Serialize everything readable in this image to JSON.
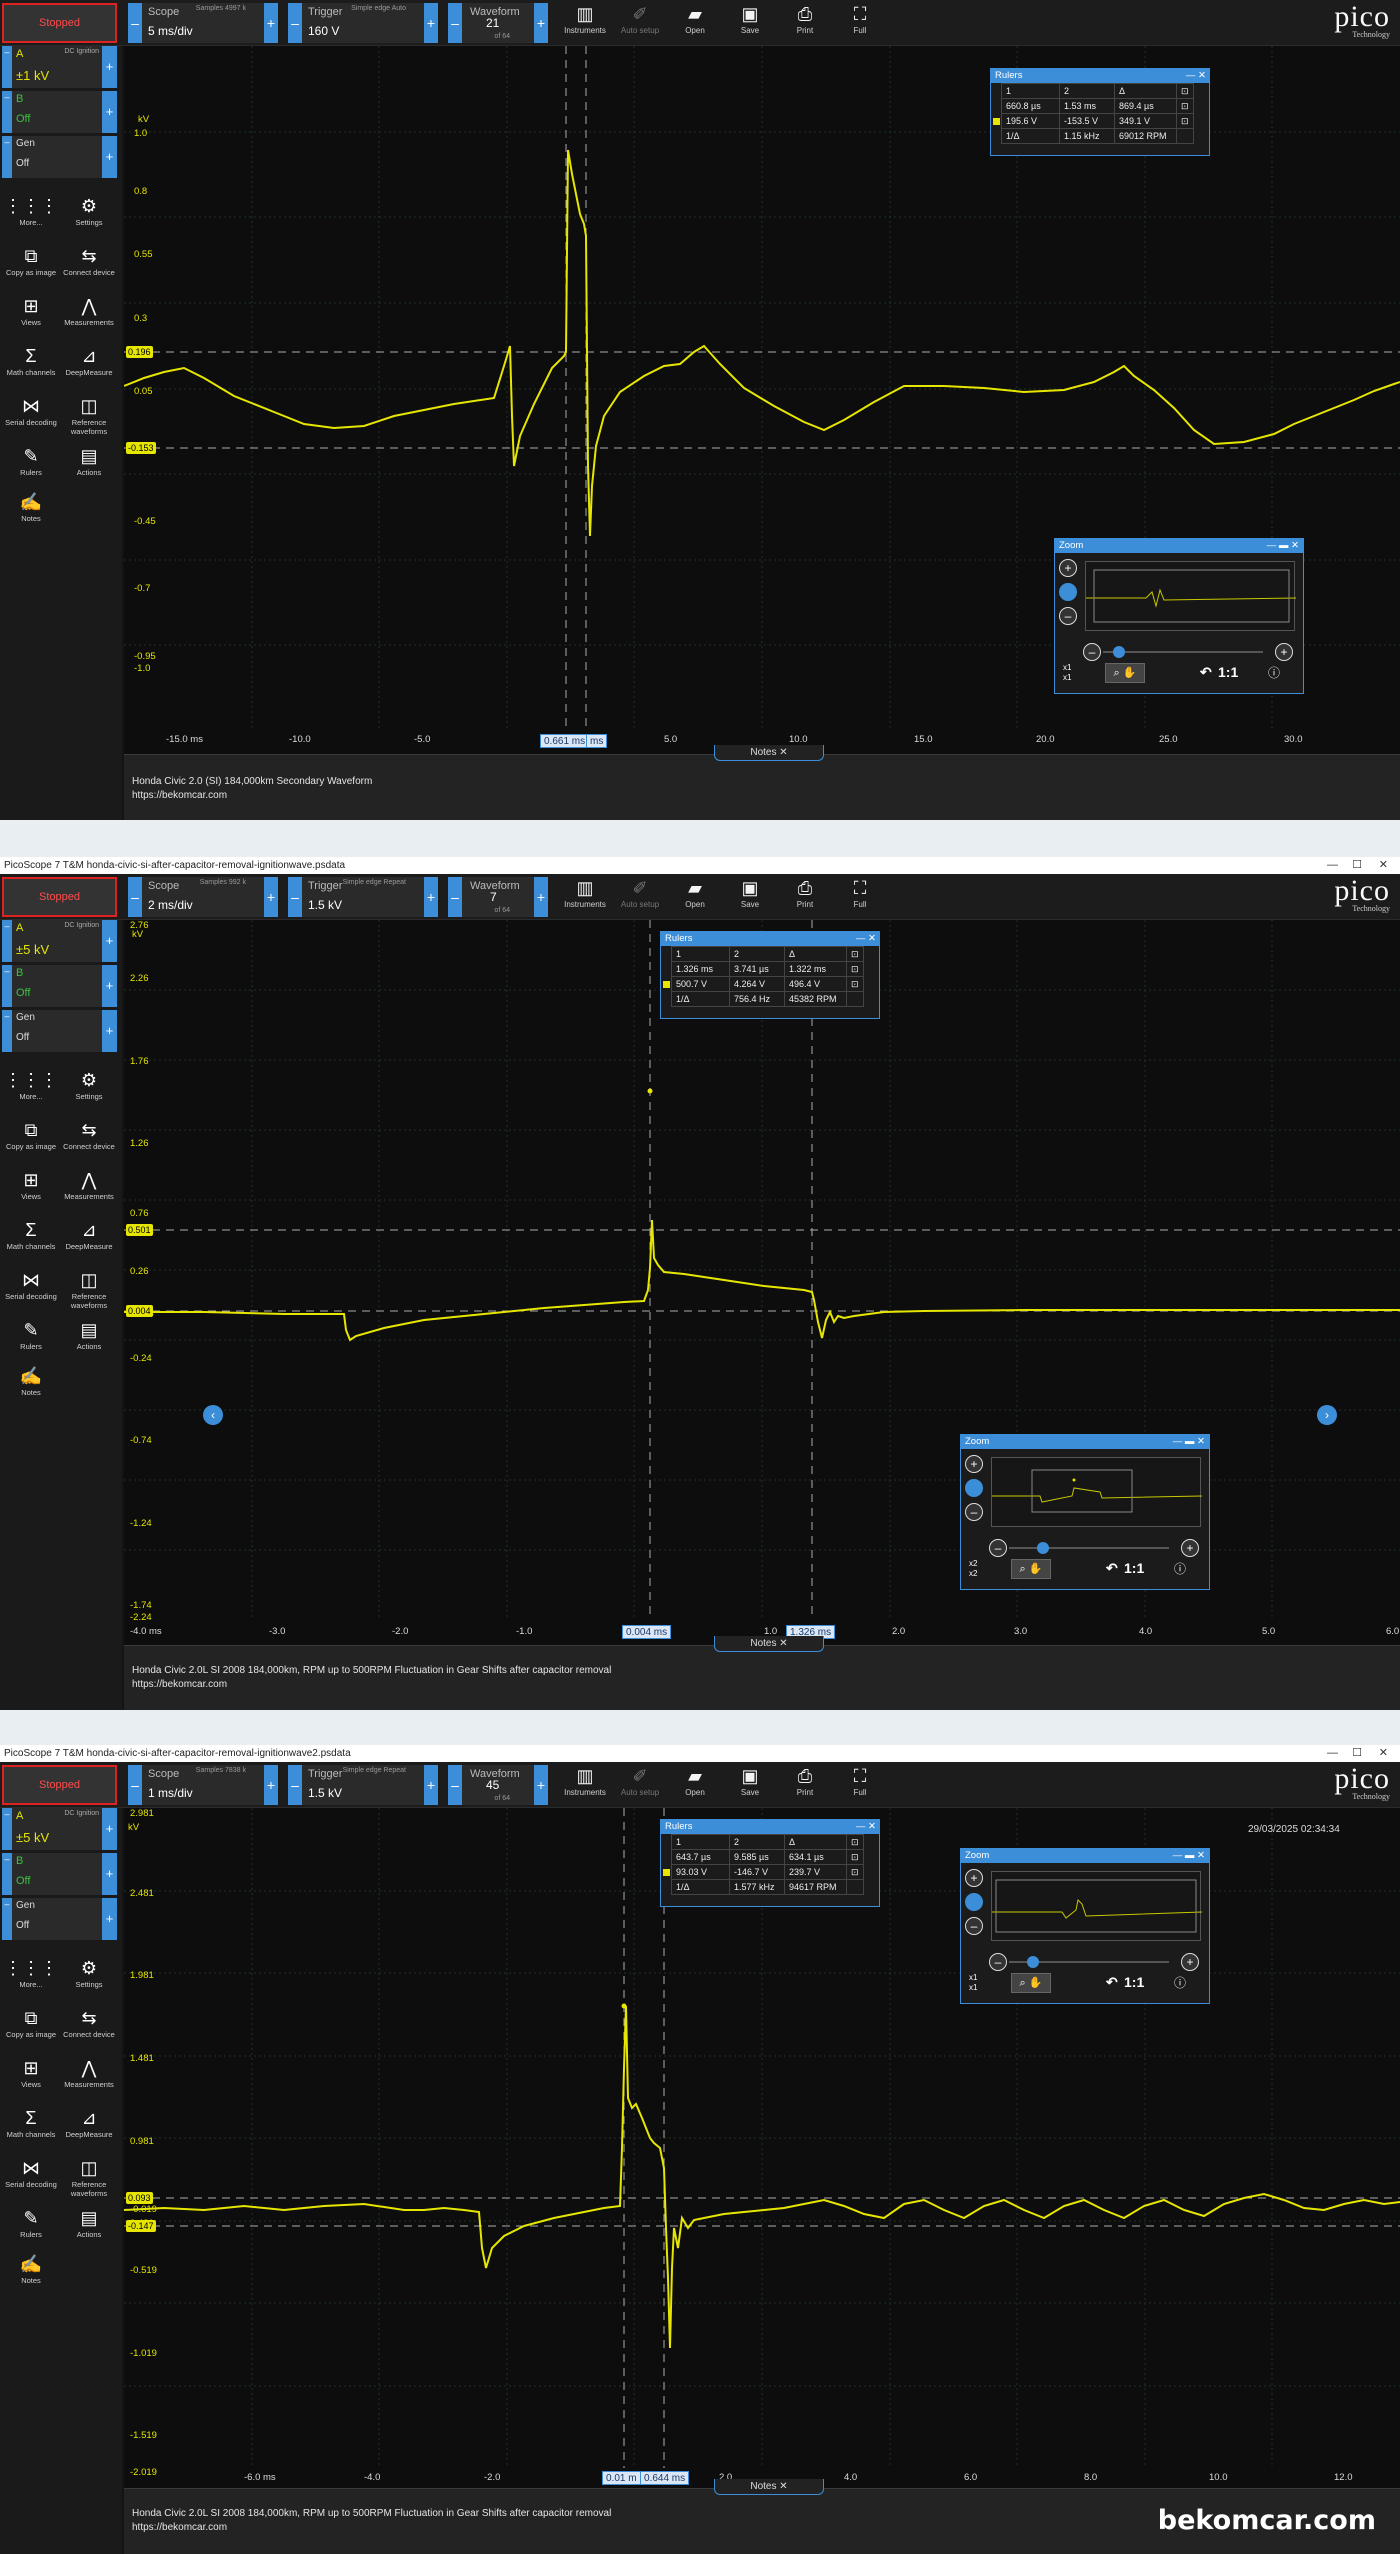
{
  "watermark": "bekomcar.com",
  "toolbar": {
    "stopped": "Stopped",
    "scope_label": "Scope",
    "trigger_label": "Trigger",
    "waveform_label": "Waveform",
    "sample_ratio": "Sample ratio",
    "instruments": "Instruments",
    "auto_setup": "Auto setup",
    "open": "Open",
    "save": "Save",
    "print": "Print",
    "full": "Full",
    "logo": "pico",
    "logo_sub": "Technology"
  },
  "sidebar": {
    "tools": [
      {
        "icon": "more-icon",
        "glyph": "⋮⋮⋮",
        "label": "More..."
      },
      {
        "icon": "settings-icon",
        "glyph": "⚙",
        "label": "Settings"
      },
      {
        "icon": "copy-image-icon",
        "glyph": "⧉",
        "label": "Copy as image"
      },
      {
        "icon": "connect-device-icon",
        "glyph": "⇆",
        "label": "Connect device"
      },
      {
        "icon": "views-icon",
        "glyph": "⊞",
        "label": "Views"
      },
      {
        "icon": "measurements-icon",
        "glyph": "⋀",
        "label": "Measurements"
      },
      {
        "icon": "math-channels-icon",
        "glyph": "Σ",
        "label": "Math channels"
      },
      {
        "icon": "deepmeasure-icon",
        "glyph": "⊿",
        "label": "DeepMeasure"
      },
      {
        "icon": "serial-decoding-icon",
        "glyph": "⋈",
        "label": "Serial decoding"
      },
      {
        "icon": "reference-waveforms-icon",
        "glyph": "◫",
        "label": "Reference waveforms"
      },
      {
        "icon": "rulers-icon",
        "glyph": "✎",
        "label": "Rulers"
      },
      {
        "icon": "actions-icon",
        "glyph": "▤",
        "label": "Actions"
      },
      {
        "icon": "notes-icon",
        "glyph": "✍",
        "label": "Notes"
      }
    ],
    "chA": "A",
    "chB": "B",
    "gen": "Gen",
    "off": "Off",
    "ignition": "DC Ignition"
  },
  "panels": [
    {
      "title": "",
      "scope_value": "5 ms/div",
      "samples": "Samples 4997 k",
      "trigger_value": "160 V",
      "trigger_mode": "Simple edge Auto",
      "trigger_pct": "22 %",
      "waveform_value": "21",
      "waveform_of": "of 64",
      "chA_range": "±1 kV",
      "y_unit": "kV",
      "y_ticks": [
        "1.0",
        "0.8",
        "0.55",
        "0.3",
        "0.05",
        "-0.2",
        "-0.45",
        "-0.7",
        "-0.95",
        "-1.0"
      ],
      "x_ticks": [
        "-15.0 ms",
        "-10.0",
        "-5.0",
        "5.0",
        "10.0",
        "15.0",
        "20.0",
        "25.0",
        "30.0"
      ],
      "level_hi": "0.196",
      "level_lo": "-0.153",
      "cursor_a": "0.661 ms",
      "cursor_b": "ms",
      "rulers": {
        "title": "Rulers",
        "h": [
          "1",
          "2",
          "Δ"
        ],
        "r1": [
          "660.8 µs",
          "1.53 ms",
          "869.4 µs"
        ],
        "r2": [
          "195.6 V",
          "-153.5 V",
          "349.1 V"
        ],
        "r3": [
          "1/Δ",
          "1.15 kHz",
          "69012 RPM"
        ]
      },
      "zoom": {
        "title": "Zoom",
        "ratio": "1:1",
        "x1": "x1",
        "x2": "x1"
      },
      "notes_tab": "Notes",
      "notes": "Honda Civic 2.0 (SI) 184,000km Secondary  Waveform\nhttps://bekomcar.com"
    },
    {
      "title": "PicoScope 7 T&M honda-civic-si-after-capacitor-removal-ignitionwave.psdata",
      "scope_value": "2 ms/div",
      "samples": "Samples 992 k",
      "trigger_value": "1.5 kV",
      "trigger_mode": "Simple edge Repeat",
      "trigger_pct": "38 %",
      "waveform_value": "7",
      "waveform_of": "of 64",
      "chA_range": "±5 kV",
      "y_unit": "kV",
      "y_ticks": [
        "2.76",
        "2.26",
        "1.76",
        "1.26",
        "0.76",
        "0.501",
        "0.26",
        "0.004",
        "-0.24",
        "-0.74",
        "-1.24",
        "-1.74",
        "-2.24"
      ],
      "x_ticks": [
        "-4.0 ms",
        "-3.0",
        "-2.0",
        "-1.0",
        "1.0",
        "2.0",
        "3.0",
        "4.0",
        "5.0",
        "6.0"
      ],
      "level_hi": "0.501",
      "level_lo": "0.004",
      "cursor_a": "0.004 ms",
      "cursor_b": "1.326 ms",
      "rulers": {
        "title": "Rulers",
        "h": [
          "1",
          "2",
          "Δ"
        ],
        "r1": [
          "1.326 ms",
          "3.741 µs",
          "1.322 ms"
        ],
        "r2": [
          "500.7 V",
          "4.264 V",
          "496.4 V"
        ],
        "r3": [
          "1/Δ",
          "756.4 Hz",
          "45382 RPM"
        ]
      },
      "zoom": {
        "title": "Zoom",
        "ratio": "1:1",
        "x1": "x2",
        "x2": "x2"
      },
      "notes_tab": "Notes",
      "notes": "Honda Civic 2.0L SI 2008 184,000km, RPM up to 500RPM Fluctuation in  Gear Shifts after capacitor removal\nhttps://bekomcar.com"
    },
    {
      "title": "PicoScope 7 T&M honda-civic-si-after-capacitor-removal-ignitionwave2.psdata",
      "scope_value": "1 ms/div",
      "samples": "Samples 7838 k",
      "trigger_value": "1.5 kV",
      "trigger_mode": "Simple edge Repeat",
      "trigger_pct": "38 %",
      "waveform_value": "45",
      "waveform_of": "of 64",
      "chA_range": "±5 kV",
      "y_unit": "kV",
      "y_ticks": [
        "2.981",
        "2.481",
        "1.981",
        "1.481",
        "0.981",
        "0.481",
        "0.093",
        "-0.019",
        "-0.519",
        "-1.019",
        "-1.519",
        "-2.019"
      ],
      "x_ticks": [
        "-6.0 ms",
        "-4.0",
        "-2.0",
        "2.0",
        "4.0",
        "6.0",
        "8.0",
        "10.0",
        "12.0"
      ],
      "level_hi": "0.093",
      "level_lo": "-0.147",
      "cursor_a": "0.01 m",
      "cursor_b": "0.644 ms",
      "timestamp": "29/03/2025 02:34:34",
      "rulers": {
        "title": "Rulers",
        "h": [
          "1",
          "2",
          "Δ"
        ],
        "r1": [
          "643.7 µs",
          "9.585 µs",
          "634.1 µs"
        ],
        "r2": [
          "93.03 V",
          "-146.7 V",
          "239.7 V"
        ],
        "r3": [
          "1/Δ",
          "1.577 kHz",
          "94617 RPM"
        ]
      },
      "zoom": {
        "title": "Zoom",
        "ratio": "1:1",
        "x1": "x1",
        "x2": "x1"
      },
      "notes_tab": "Notes",
      "notes": "Honda Civic 2.0L SI 2008 184,000km, RPM up to 500RPM Fluctuation in  Gear Shifts after capacitor removal\nhttps://bekomcar.com"
    }
  ],
  "colors": {
    "trace": "#e6e600",
    "accent": "#3d8ed8",
    "grid": "#2a3a2a",
    "stop": "#d22222"
  }
}
